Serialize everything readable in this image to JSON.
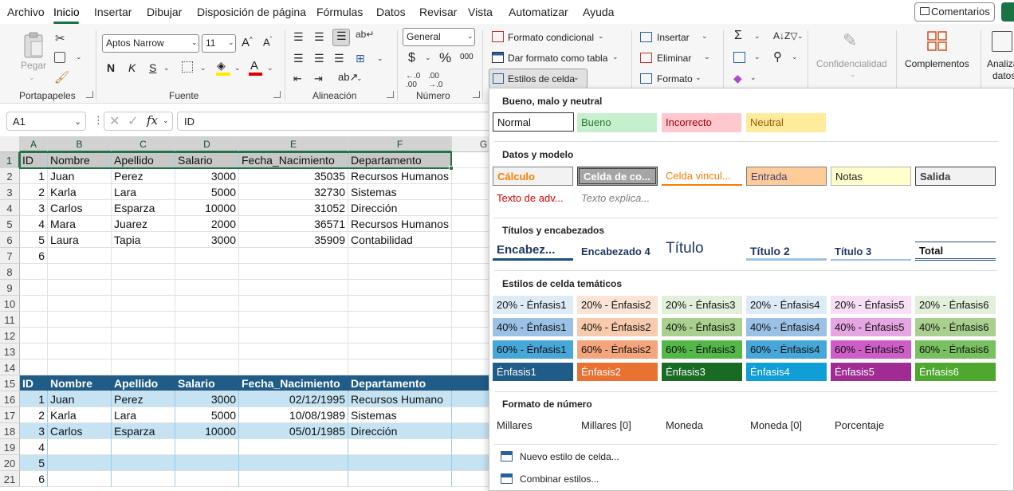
{
  "menu": {
    "items": [
      "Archivo",
      "Inicio",
      "Insertar",
      "Dibujar",
      "Disposición de página",
      "Fórmulas",
      "Datos",
      "Revisar",
      "Vista",
      "Automatizar",
      "Ayuda"
    ],
    "active": "Inicio",
    "comments_label": "Comentarios"
  },
  "ribbon": {
    "paste_label": "Pegar",
    "clipboard_label": "Portapapeles",
    "font_name": "Aptos Narrow",
    "font_size": "11",
    "font_label": "Fuente",
    "bold": "N",
    "italic": "K",
    "underline": "S",
    "alignment_label": "Alineación",
    "number_format": "General",
    "number_label": "Número",
    "currency_symbol": "$",
    "percent_symbol": "%",
    "conditional_format": "Formato condicional",
    "format_as_table": "Dar formato como tabla",
    "cell_styles": "Estilos de celda",
    "insert": "Insertar",
    "delete": "Eliminar",
    "format": "Formato",
    "confidentiality": "Confidencialidad",
    "addins": "Complementos",
    "analyze": "Analiza",
    "analyze2": "datos",
    "accent_green": "#1a7343"
  },
  "formula_bar": {
    "name_box": "A1",
    "fx": "fx",
    "content": "ID"
  },
  "sheet": {
    "columns": [
      "A",
      "B",
      "C",
      "D",
      "E",
      "F",
      "G"
    ],
    "rows": [
      "1",
      "2",
      "3",
      "4",
      "5",
      "6",
      "7",
      "8",
      "9",
      "10",
      "11",
      "12",
      "13",
      "14",
      "15",
      "16",
      "17",
      "18",
      "19",
      "20",
      "21"
    ],
    "table1": {
      "headers": [
        "ID",
        "Nombre",
        "Apellido",
        "Salario",
        "Fecha_Nacimiento",
        "Departamento"
      ],
      "rows": [
        [
          "1",
          "Juan",
          "Perez",
          "3000",
          "35035",
          "Recursos Humanos"
        ],
        [
          "2",
          "Karla",
          "Lara",
          "5000",
          "32730",
          "Sistemas"
        ],
        [
          "3",
          "Carlos",
          "Esparza",
          "10000",
          "31052",
          "Dirección"
        ],
        [
          "4",
          "Mara",
          "Juarez",
          "2000",
          "36571",
          "Recursos Humanos"
        ],
        [
          "5",
          "Laura",
          "Tapia",
          "3000",
          "35909",
          "Contabilidad"
        ],
        [
          "6",
          "",
          "",
          "",
          "",
          ""
        ]
      ]
    },
    "table2": {
      "headers": [
        "ID",
        "Nombre",
        "Apellido",
        "Salario",
        "Fecha_Nacimiento",
        "Departamento"
      ],
      "rows": [
        [
          "1",
          "Juan",
          "Perez",
          "3000",
          "02/12/1995",
          "Recursos Humano"
        ],
        [
          "2",
          "Karla",
          "Lara",
          "5000",
          "10/08/1989",
          "Sistemas"
        ],
        [
          "3",
          "Carlos",
          "Esparza",
          "10000",
          "05/01/1985",
          "Dirección"
        ],
        [
          "4",
          "",
          "",
          "",
          "",
          ""
        ],
        [
          "5",
          "",
          "",
          "",
          "",
          ""
        ],
        [
          "6",
          "",
          "",
          "",
          "",
          ""
        ]
      ]
    }
  },
  "cell_styles": {
    "sections": [
      "Bueno, malo y neutral",
      "Datos y modelo",
      "Títulos y encabezados",
      "Estilos de celda temáticos",
      "Formato de número"
    ],
    "good_bad": [
      "Normal",
      "Bueno",
      "Incorrecto",
      "Neutral"
    ],
    "data_model": [
      "Cálculo",
      "Celda de co...",
      "Celda vincul...",
      "Entrada",
      "Notas",
      "Salida"
    ],
    "data_model2": [
      "Texto de adv...",
      "Texto explica..."
    ],
    "titles": [
      "Encabez...",
      "Encabezado 4",
      "Título",
      "Título 2",
      "Título 3",
      "Total"
    ],
    "theme20": [
      "20% - Énfasis1",
      "20% - Énfasis2",
      "20% - Énfasis3",
      "20% - Énfasis4",
      "20% - Énfasis5",
      "20% - Énfasis6"
    ],
    "theme40": [
      "40% - Énfasis1",
      "40% - Énfasis2",
      "40% - Énfasis3",
      "40% - Énfasis4",
      "40% - Énfasis5",
      "40% - Énfasis6"
    ],
    "theme60": [
      "60% - Énfasis1",
      "60% - Énfasis2",
      "60% - Énfasis3",
      "60% - Énfasis4",
      "60% - Énfasis5",
      "60% - Énfasis6"
    ],
    "accents": [
      "Énfasis1",
      "Énfasis2",
      "Énfasis3",
      "Énfasis4",
      "Énfasis5",
      "Énfasis6"
    ],
    "number_formats": [
      "Millares",
      "Millares [0]",
      "Moneda",
      "Moneda [0]",
      "Porcentaje"
    ],
    "new_style": "Nuevo estilo de celda...",
    "merge_styles": "Combinar estilos..."
  }
}
